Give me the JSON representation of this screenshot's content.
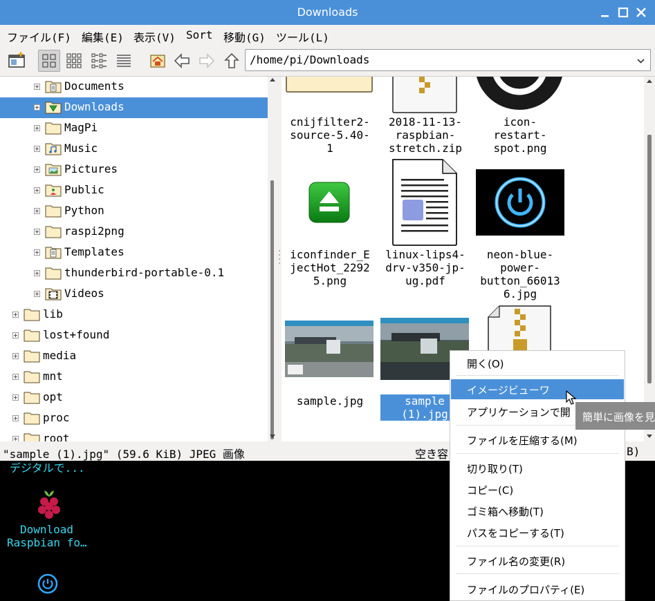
{
  "window": {
    "title": "Downloads"
  },
  "menubar": [
    "ファイル(F)",
    "編集(E)",
    "表示(V)",
    "Sort",
    "移動(G)",
    "ツール(L)"
  ],
  "path": {
    "value": "/home/pi/Downloads"
  },
  "tree": [
    {
      "label": "Documents",
      "icon": "documents-folder-icon",
      "level": 2,
      "selected": false
    },
    {
      "label": "Downloads",
      "icon": "downloads-folder-icon",
      "level": 2,
      "selected": true
    },
    {
      "label": "MagPi",
      "icon": "folder-icon",
      "level": 2,
      "selected": false
    },
    {
      "label": "Music",
      "icon": "music-folder-icon",
      "level": 2,
      "selected": false
    },
    {
      "label": "Pictures",
      "icon": "pictures-folder-icon",
      "level": 2,
      "selected": false
    },
    {
      "label": "Public",
      "icon": "public-folder-icon",
      "level": 2,
      "selected": false
    },
    {
      "label": "Python",
      "icon": "folder-icon",
      "level": 2,
      "selected": false
    },
    {
      "label": "raspi2png",
      "icon": "folder-icon",
      "level": 2,
      "selected": false
    },
    {
      "label": "Templates",
      "icon": "templates-folder-icon",
      "level": 2,
      "selected": false
    },
    {
      "label": "thunderbird-portable-0.1",
      "icon": "folder-icon",
      "level": 2,
      "selected": false
    },
    {
      "label": "Videos",
      "icon": "videos-folder-icon",
      "level": 2,
      "selected": false
    },
    {
      "label": "lib",
      "icon": "folder-icon",
      "level": 1,
      "selected": false
    },
    {
      "label": "lost+found",
      "icon": "folder-icon",
      "level": 1,
      "selected": false
    },
    {
      "label": "media",
      "icon": "folder-icon",
      "level": 1,
      "selected": false
    },
    {
      "label": "mnt",
      "icon": "folder-icon",
      "level": 1,
      "selected": false
    },
    {
      "label": "opt",
      "icon": "folder-icon",
      "level": 1,
      "selected": false
    },
    {
      "label": "proc",
      "icon": "folder-icon",
      "level": 1,
      "selected": false
    },
    {
      "label": "root",
      "icon": "folder-icon",
      "level": 1,
      "selected": false
    }
  ],
  "files": [
    {
      "label": "cnijfilter2-\nsource-5.40-\n1",
      "icon": "folder-icon"
    },
    {
      "label": "2018-11-13-\nraspbian-\nstretch.zip",
      "icon": "zip-archive-icon"
    },
    {
      "label": "icon-\nrestart-\nspot.png",
      "icon": "restart-image-icon"
    },
    {
      "label": "iconfinder_E\njectHot_2292\n5.png",
      "icon": "eject-image-icon"
    },
    {
      "label": "linux-lips4-\ndrv-v350-jp-\nug.pdf",
      "icon": "pdf-document-icon"
    },
    {
      "label": "neon-blue-\npower-\nbutton_66013\n6.jpg",
      "icon": "power-button-image-icon"
    },
    {
      "label": "sample.jpg",
      "icon": "photo-thumbnail-icon"
    },
    {
      "label": "sample\n(1).jpg",
      "icon": "photo-thumbnail-icon",
      "selected": true
    },
    {
      "label": "",
      "icon": "zip-archive-icon"
    }
  ],
  "status": {
    "left": "\"sample (1).jpg\" (59.6 KiB) JPEG 画像",
    "right_prefix": "空き容",
    "right_suffix": "B)"
  },
  "context_menu": [
    {
      "label": "開く(O)"
    },
    {
      "label": "イメージビューワ",
      "highlighted": true
    },
    {
      "label": "アプリケーションで開"
    },
    {
      "label": "ファイルを圧縮する(M)"
    },
    {
      "label": "切り取り(T)"
    },
    {
      "label": "コピー(C)"
    },
    {
      "label": "ゴミ箱へ移動(T)"
    },
    {
      "label": "パスをコピーする(T)"
    },
    {
      "label": "ファイル名の変更(R)"
    },
    {
      "label": "ファイルのプロパティ(E)"
    }
  ],
  "tooltip": "簡単に画像を見",
  "desktop": {
    "partial_text": "デジタルで...",
    "raspbian_label_1": "Download",
    "raspbian_label_2": "Raspbian fo…"
  },
  "colors": {
    "accent": "#4a90d9",
    "desktop_text": "#38d7ec"
  }
}
